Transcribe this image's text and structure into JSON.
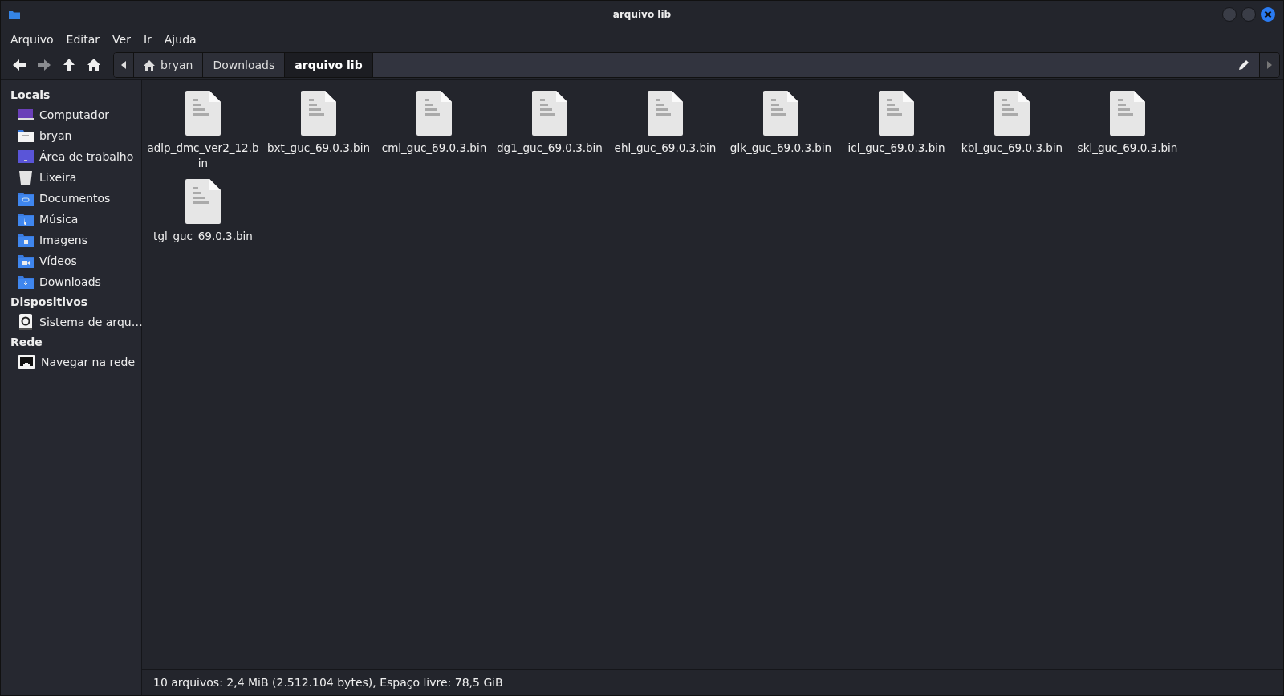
{
  "window": {
    "title": "arquivo lib"
  },
  "menu": [
    "Arquivo",
    "Editar",
    "Ver",
    "Ir",
    "Ajuda"
  ],
  "nav_buttons": [
    {
      "kind": "back",
      "disabled": false
    },
    {
      "kind": "forward",
      "disabled": true
    },
    {
      "kind": "up",
      "disabled": false
    },
    {
      "kind": "home",
      "disabled": false
    }
  ],
  "path_bar": {
    "crumbs": [
      {
        "label": "bryan",
        "kind": "home",
        "selected": false
      },
      {
        "label": "Downloads",
        "kind": "folder",
        "selected": false
      },
      {
        "label": "arquivo lib",
        "kind": "folder",
        "selected": true
      }
    ]
  },
  "sidebar": {
    "sections": [
      {
        "title": "Locais",
        "items": [
          {
            "label": "Computador",
            "kind": "computer"
          },
          {
            "label": "bryan",
            "kind": "home"
          },
          {
            "label": "Área de trabalho",
            "kind": "desktop"
          },
          {
            "label": "Lixeira",
            "kind": "trash"
          },
          {
            "label": "Documentos",
            "kind": "documents"
          },
          {
            "label": "Música",
            "kind": "music"
          },
          {
            "label": "Imagens",
            "kind": "pictures"
          },
          {
            "label": "Vídeos",
            "kind": "videos"
          },
          {
            "label": "Downloads",
            "kind": "downloads"
          }
        ]
      },
      {
        "title": "Dispositivos",
        "items": [
          {
            "label": "Sistema de arqu…",
            "kind": "drive"
          }
        ]
      },
      {
        "title": "Rede",
        "items": [
          {
            "label": "Navegar na rede",
            "kind": "network"
          }
        ]
      }
    ]
  },
  "files": [
    {
      "name": "adlp_dmc_ver2_12.bin"
    },
    {
      "name": "bxt_guc_69.0.3.bin"
    },
    {
      "name": "cml_guc_69.0.3.bin"
    },
    {
      "name": "dg1_guc_69.0.3.bin"
    },
    {
      "name": "ehl_guc_69.0.3.bin"
    },
    {
      "name": "glk_guc_69.0.3.bin"
    },
    {
      "name": "icl_guc_69.0.3.bin"
    },
    {
      "name": "kbl_guc_69.0.3.bin"
    },
    {
      "name": "skl_guc_69.0.3.bin"
    },
    {
      "name": "tgl_guc_69.0.3.bin"
    }
  ],
  "status_bar": "10 arquivos: 2,4 MiB (2.512.104 bytes), Espaço livre: 78,5 GiB"
}
